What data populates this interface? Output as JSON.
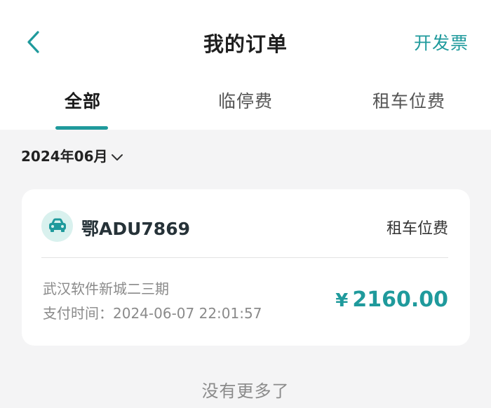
{
  "header": {
    "title": "我的订单",
    "invoice_label": "开发票",
    "back_icon": "chevron-left-icon",
    "accent_color": "#1f9a9c"
  },
  "tabs": [
    {
      "label": "全部",
      "active": true
    },
    {
      "label": "临停费",
      "active": false
    },
    {
      "label": "租车位费",
      "active": false
    }
  ],
  "filter": {
    "month": "2024年06月",
    "icon": "chevron-down-icon"
  },
  "orders": [
    {
      "vehicle_icon": "car-icon",
      "plate": "鄂ADU7869",
      "fee_type": "租车位费",
      "location": "武汉软件新城二三期",
      "pay_time_label": "支付时间：",
      "pay_time": "2024-06-07 22:01:57",
      "currency": "¥",
      "amount": "2160.00"
    }
  ],
  "footer": {
    "no_more": "没有更多了"
  }
}
